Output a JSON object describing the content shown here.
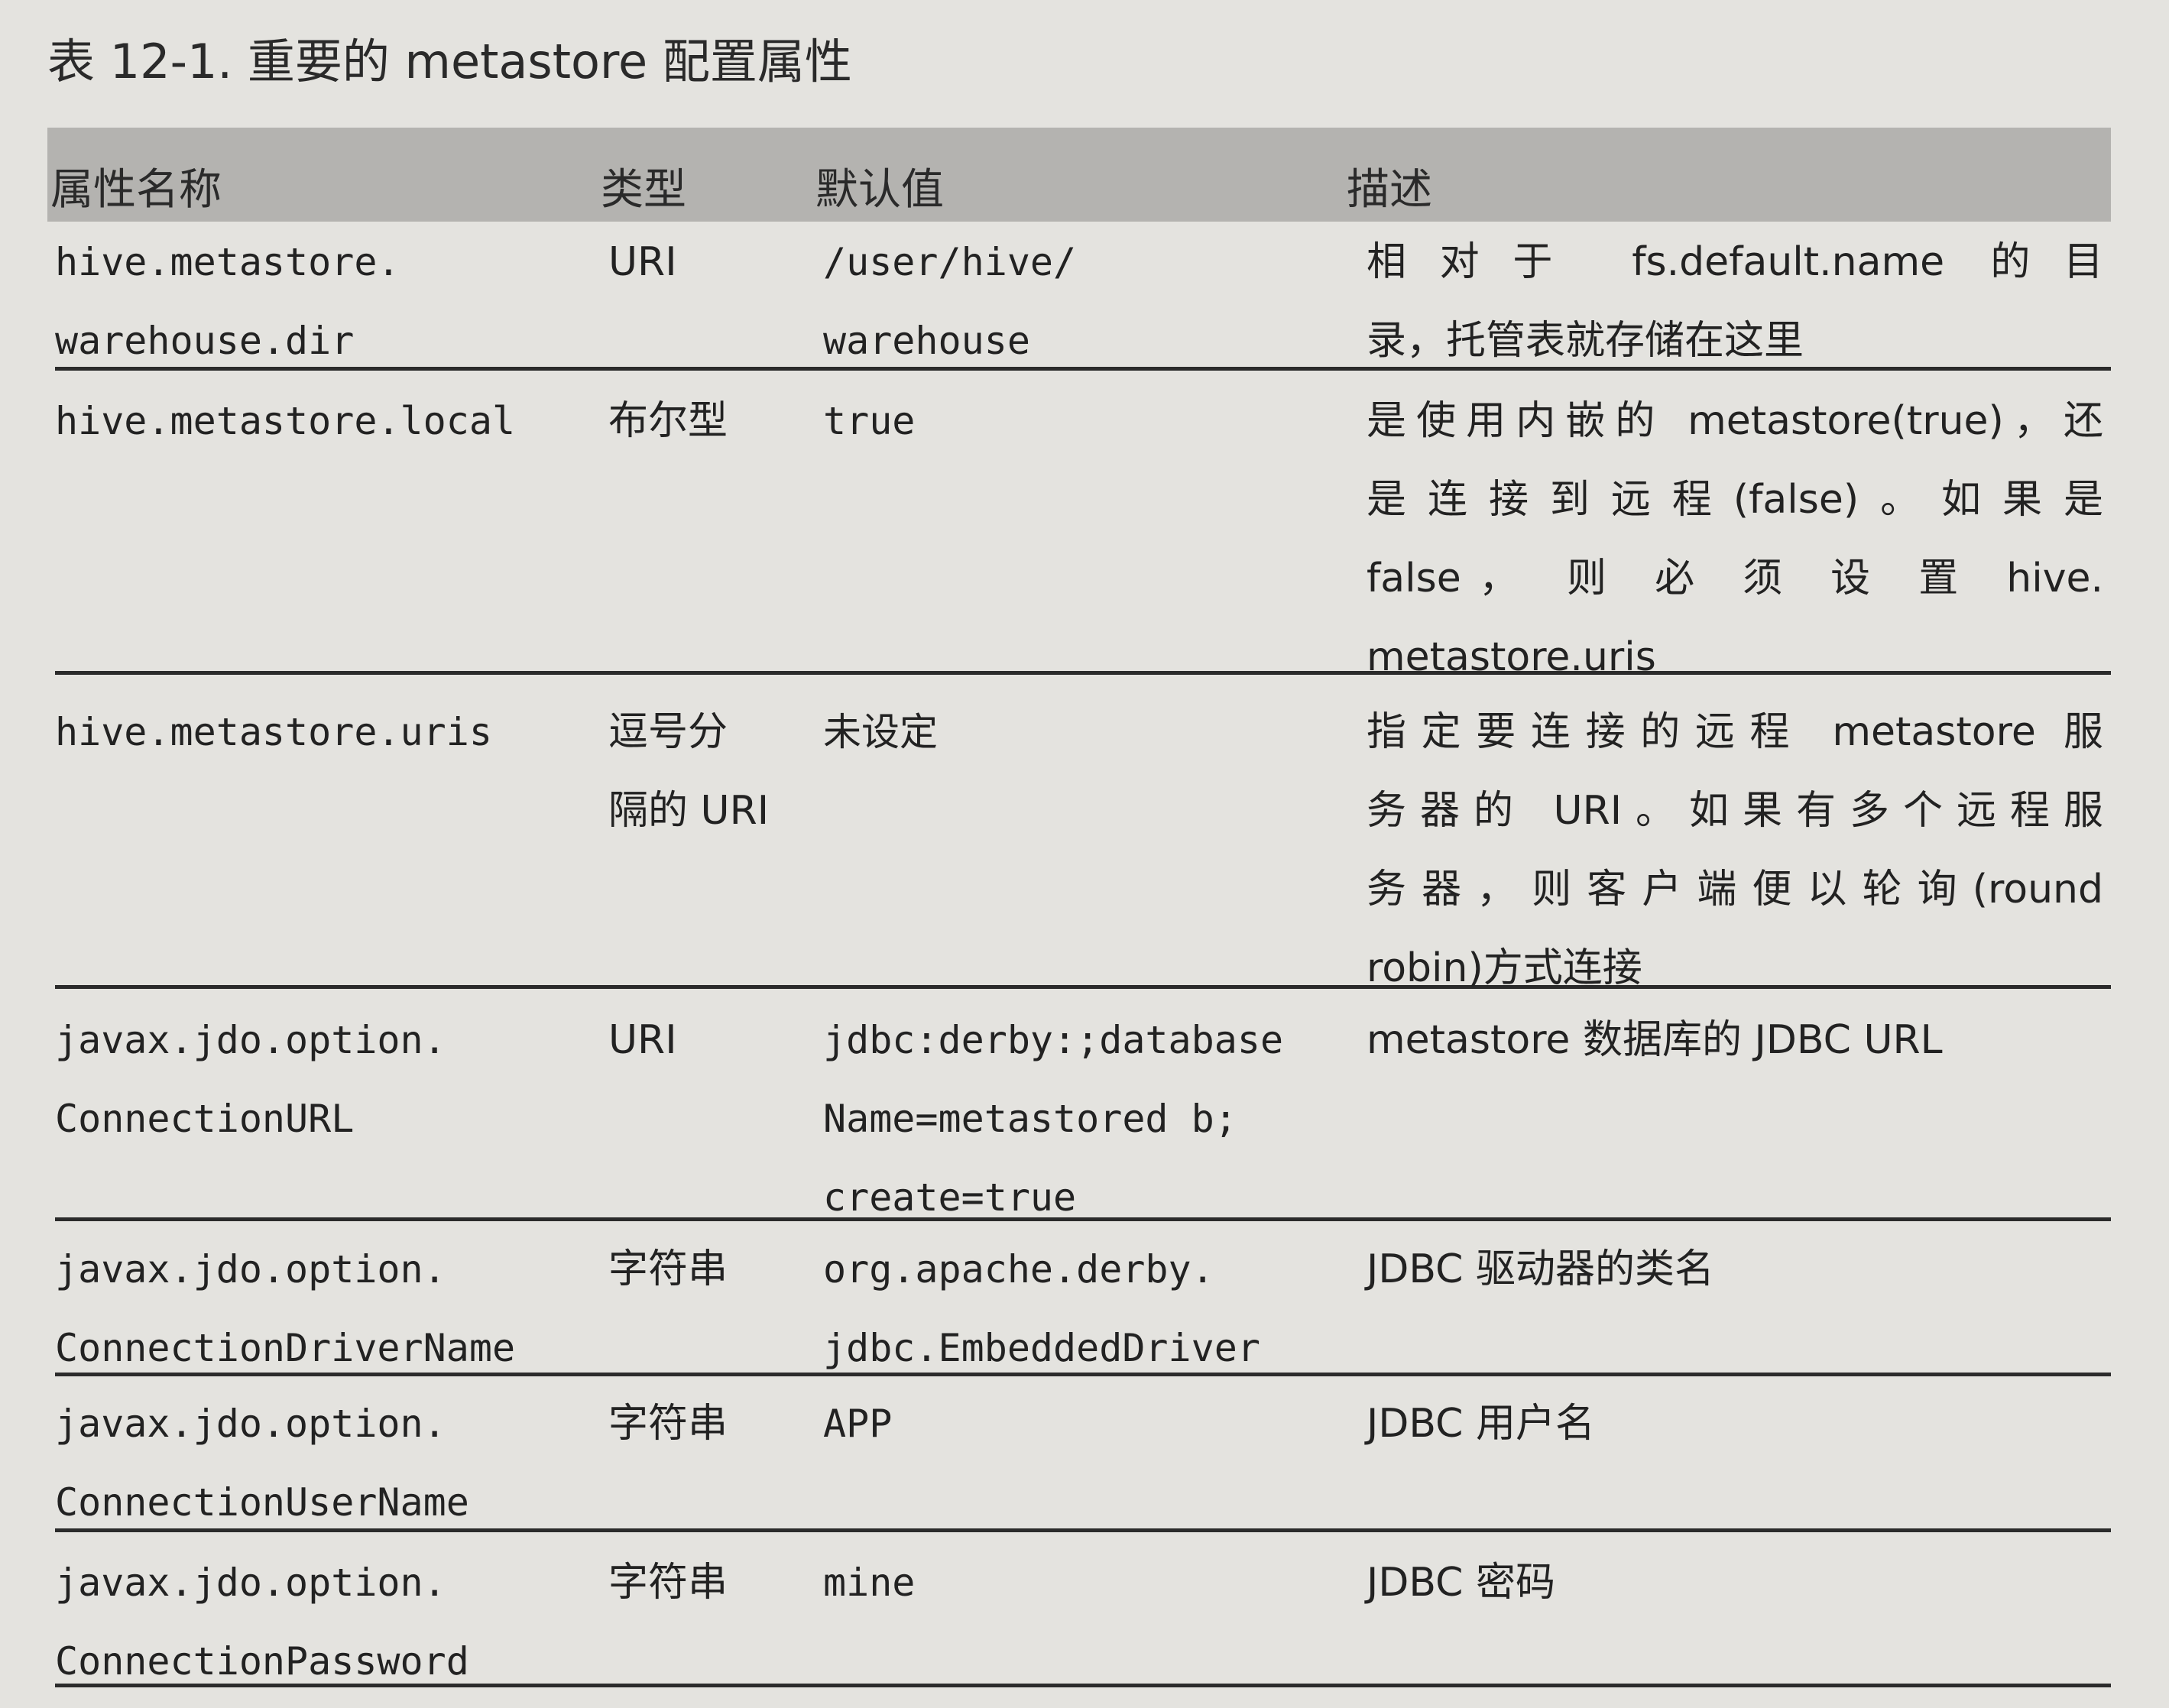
{
  "caption": "表 12-1. 重要的 metastore 配置属性",
  "headers": [
    "属性名称",
    "类型",
    "默认值",
    "描述"
  ],
  "rows": [
    {
      "name": [
        "hive.metastore.",
        "warehouse.dir"
      ],
      "type": [
        "URI"
      ],
      "default": [
        "/user/hive/",
        "warehouse"
      ],
      "description": [
        "相对于 fs.default.name 的目",
        "录，托管表就存储在这里"
      ]
    },
    {
      "name": [
        "hive.metastore.local"
      ],
      "type": [
        "布尔型"
      ],
      "default": [
        "true"
      ],
      "description": [
        "是使用内嵌的 metastore(true)，还",
        "是连接到远程(false)。如果是",
        "false， 则 必 须 设 置  hive.",
        "metastore.uris"
      ]
    },
    {
      "name": [
        "hive.metastore.uris"
      ],
      "type": [
        "逗号分",
        "隔的 URI"
      ],
      "default": [
        "未设定"
      ],
      "description": [
        "指定要连接的远程 metastore 服",
        "务器的 URI。如果有多个远程服",
        "务器，则客户端便以轮询(round",
        "robin)方式连接"
      ]
    },
    {
      "name": [
        "javax.jdo.option.",
        "ConnectionURL"
      ],
      "type": [
        "URI"
      ],
      "default": [
        "jdbc:derby:;database",
        "Name=metastored b;",
        "create=true"
      ],
      "description": [
        "metastore 数据库的 JDBC URL"
      ]
    },
    {
      "name": [
        "javax.jdo.option.",
        "ConnectionDriverName"
      ],
      "type": [
        "字符串"
      ],
      "default": [
        "org.apache.derby.",
        "jdbc.EmbeddedDriver"
      ],
      "description": [
        "JDBC 驱动器的类名"
      ]
    },
    {
      "name": [
        "javax.jdo.option.",
        "ConnectionUserName"
      ],
      "type": [
        "字符串"
      ],
      "default": [
        "APP"
      ],
      "description": [
        "JDBC 用户名"
      ]
    },
    {
      "name": [
        "javax.jdo.option.",
        "ConnectionPassword"
      ],
      "type": [
        "字符串"
      ],
      "default": [
        "mine"
      ],
      "description": [
        "JDBC 密码"
      ]
    }
  ]
}
